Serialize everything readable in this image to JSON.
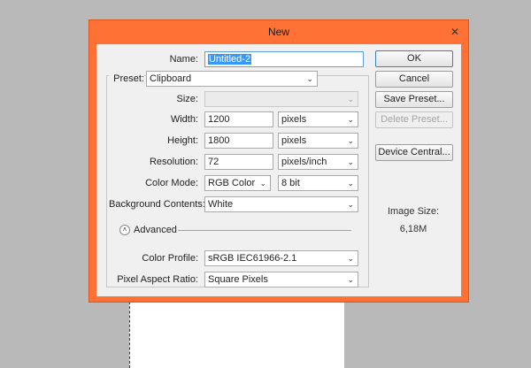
{
  "dialog": {
    "title": "New",
    "close_glyph": "✕"
  },
  "form": {
    "name_label": "Name:",
    "name_value": "Untitled-2",
    "preset_label": "Preset:",
    "preset_value": "Clipboard",
    "size_label": "Size:",
    "size_value": "",
    "width_label": "Width:",
    "width_value": "1200",
    "width_unit": "pixels",
    "height_label": "Height:",
    "height_value": "1800",
    "height_unit": "pixels",
    "resolution_label": "Resolution:",
    "resolution_value": "72",
    "resolution_unit": "pixels/inch",
    "color_mode_label": "Color Mode:",
    "color_mode_value": "RGB Color",
    "bit_depth_value": "8 bit",
    "background_label": "Background Contents:",
    "background_value": "White",
    "advanced_label": "Advanced",
    "color_profile_label": "Color Profile:",
    "color_profile_value": "sRGB IEC61966-2.1",
    "pixel_aspect_label": "Pixel Aspect Ratio:",
    "pixel_aspect_value": "Square Pixels"
  },
  "buttons": {
    "ok": "OK",
    "cancel": "Cancel",
    "save_preset": "Save Preset...",
    "delete_preset": "Delete Preset...",
    "device_central": "Device Central..."
  },
  "image_size": {
    "label": "Image Size:",
    "value": "6,18M"
  },
  "icons": {
    "dropdown": "chevron-down-icon",
    "advanced": "collapse-toggle-icon"
  },
  "colors": {
    "dialog_frame": "#ff7134",
    "selection": "#3399ff"
  }
}
